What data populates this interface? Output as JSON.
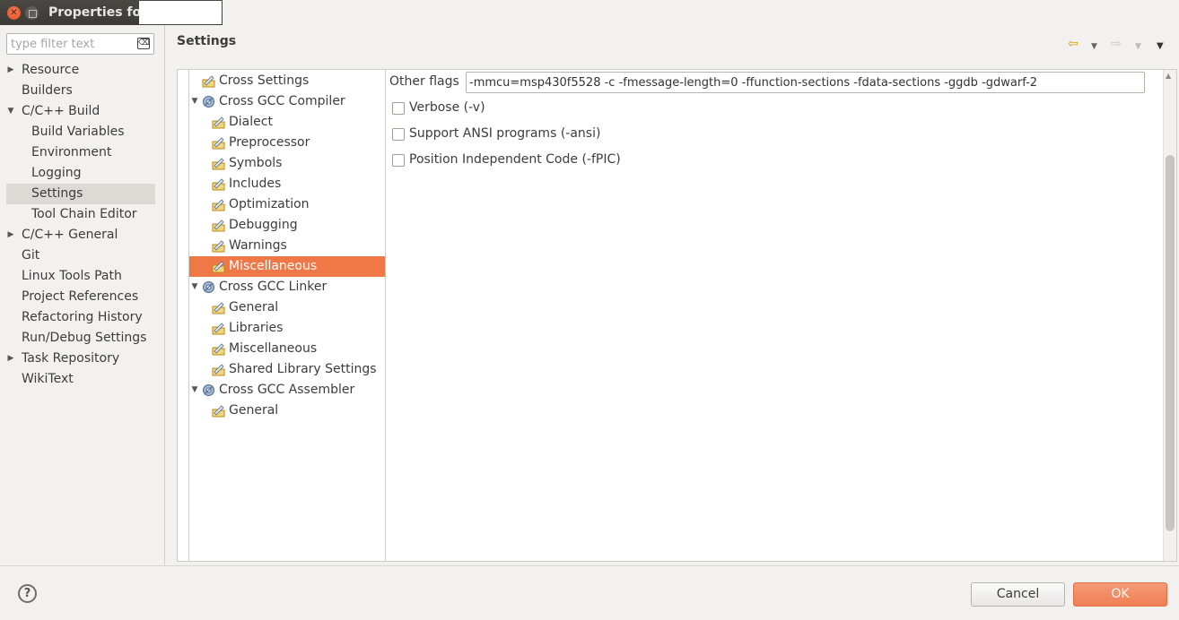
{
  "window": {
    "title": "Properties for"
  },
  "sidebar": {
    "filter_placeholder": "type filter text",
    "items": [
      {
        "label": "Resource",
        "expandable": true
      },
      {
        "label": "Builders"
      },
      {
        "label": "C/C++ Build",
        "expanded": true
      },
      {
        "label": "Build Variables",
        "child": true
      },
      {
        "label": "Environment",
        "child": true
      },
      {
        "label": "Logging",
        "child": true
      },
      {
        "label": "Settings",
        "child": true,
        "selected": true
      },
      {
        "label": "Tool Chain Editor",
        "child": true
      },
      {
        "label": "C/C++ General",
        "expandable": true
      },
      {
        "label": "Git"
      },
      {
        "label": "Linux Tools Path"
      },
      {
        "label": "Project References"
      },
      {
        "label": "Refactoring History"
      },
      {
        "label": "Run/Debug Settings"
      },
      {
        "label": "Task Repository",
        "expandable": true
      },
      {
        "label": "WikiText"
      }
    ]
  },
  "header": {
    "title": "Settings"
  },
  "tool_tree": {
    "items": [
      {
        "label": "Cross Settings",
        "icon": "settings-icon"
      },
      {
        "label": "Cross GCC Compiler",
        "icon": "tool-icon",
        "expanded": true
      },
      {
        "label": "Dialect",
        "icon": "settings-icon",
        "child": true
      },
      {
        "label": "Preprocessor",
        "icon": "settings-icon",
        "child": true
      },
      {
        "label": "Symbols",
        "icon": "settings-icon",
        "child": true
      },
      {
        "label": "Includes",
        "icon": "settings-icon",
        "child": true
      },
      {
        "label": "Optimization",
        "icon": "settings-icon",
        "child": true
      },
      {
        "label": "Debugging",
        "icon": "settings-icon",
        "child": true
      },
      {
        "label": "Warnings",
        "icon": "settings-icon",
        "child": true
      },
      {
        "label": "Miscellaneous",
        "icon": "settings-icon",
        "child": true,
        "selected": true
      },
      {
        "label": "Cross GCC Linker",
        "icon": "tool-icon",
        "expanded": true
      },
      {
        "label": "General",
        "icon": "settings-icon",
        "child": true
      },
      {
        "label": "Libraries",
        "icon": "settings-icon",
        "child": true
      },
      {
        "label": "Miscellaneous",
        "icon": "settings-icon",
        "child": true
      },
      {
        "label": "Shared Library Settings",
        "icon": "settings-icon",
        "child": true
      },
      {
        "label": "Cross GCC Assembler",
        "icon": "tool-icon",
        "expanded": true
      },
      {
        "label": "General",
        "icon": "settings-icon",
        "child": true
      }
    ]
  },
  "options": {
    "other_flags_label": "Other flags",
    "other_flags_value": "-mmcu=msp430f5528 -c -fmessage-length=0 -ffunction-sections -fdata-sections -ggdb -gdwarf-2",
    "checkboxes": [
      {
        "label": "Verbose (-v)",
        "checked": false
      },
      {
        "label": "Support ANSI programs (-ansi)",
        "checked": false
      },
      {
        "label": "Position Independent Code (-fPIC)",
        "checked": false
      }
    ]
  },
  "footer": {
    "help_label": "?",
    "cancel_label": "Cancel",
    "ok_label": "OK"
  },
  "colors": {
    "accent": "#f07746",
    "selection_gray": "#dcdad5",
    "window_bg": "#f2f1f0"
  }
}
